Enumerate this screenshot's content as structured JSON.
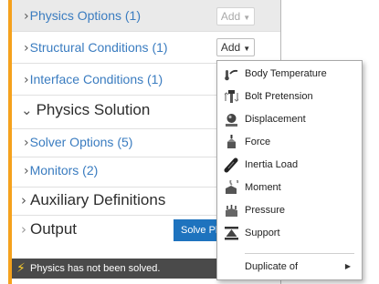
{
  "sections": {
    "physics_options": "Physics Options (1)",
    "structural_conditions": "Structural Conditions (1)",
    "interface_conditions": "Interface Conditions (1)",
    "physics_solution": "Physics Solution",
    "solver_options": "Solver Options (5)",
    "monitors": "Monitors (2)",
    "auxiliary_definitions": "Auxiliary Definitions",
    "output": "Output"
  },
  "chevrons": {
    "right": "›",
    "down": "⌄"
  },
  "buttons": {
    "add_label": "Add",
    "caret": "▼",
    "solve_label": "Solve Physics"
  },
  "status": {
    "icon": "lightning-bolt-icon",
    "glyph": "⚡",
    "text": "Physics has not been solved."
  },
  "menu": {
    "items": [
      {
        "label": "Body Temperature",
        "icon": "thermometer-icon"
      },
      {
        "label": "Bolt Pretension",
        "icon": "bolt-icon"
      },
      {
        "label": "Displacement",
        "icon": "displacement-icon"
      },
      {
        "label": "Force",
        "icon": "force-icon"
      },
      {
        "label": "Inertia Load",
        "icon": "inertia-load-icon"
      },
      {
        "label": "Moment",
        "icon": "moment-icon"
      },
      {
        "label": "Pressure",
        "icon": "pressure-icon"
      },
      {
        "label": "Support",
        "icon": "support-icon"
      }
    ],
    "duplicate_label": "Duplicate of",
    "submenu_arrow": "▶"
  },
  "colors": {
    "accent": "#f5a11c",
    "link": "#3a7cc0",
    "solve_button": "#1e73be",
    "status_bar": "#4a4a4a"
  }
}
